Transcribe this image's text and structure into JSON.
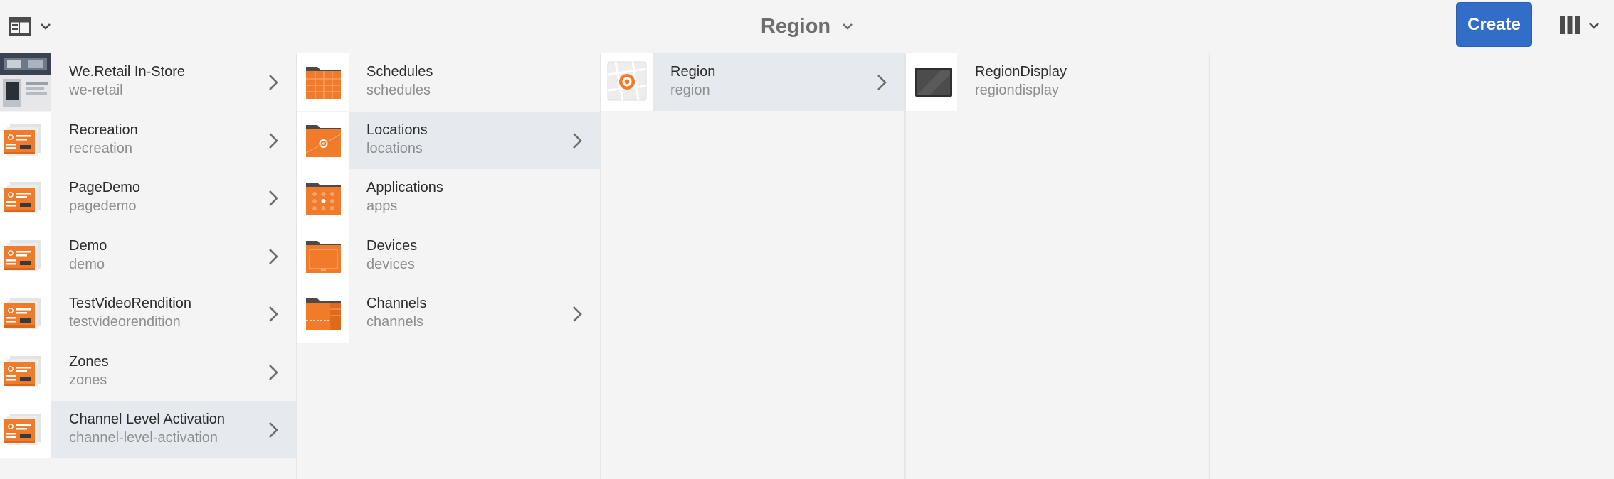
{
  "header": {
    "title": "Region",
    "create_label": "Create"
  },
  "icons": {
    "rail_toggle": "sidebar-panel-icon",
    "title_dropdown": "chevron-down-icon",
    "view_switch": "column-view-icon",
    "item_arrow": "chevron-right-icon"
  },
  "colors": {
    "primary_button": "#326ec8",
    "folder_orange": "#f07b2b",
    "active_row": "#e6e9ee"
  },
  "columns": [
    {
      "items": [
        {
          "title": "We.Retail In-Store",
          "name": "we-retail",
          "thumb": "photo",
          "has_children": true,
          "active": false
        },
        {
          "title": "Recreation",
          "name": "recreation",
          "thumb": "project",
          "has_children": true,
          "active": false
        },
        {
          "title": "PageDemo",
          "name": "pagedemo",
          "thumb": "project",
          "has_children": true,
          "active": false
        },
        {
          "title": "Demo",
          "name": "demo",
          "thumb": "project",
          "has_children": true,
          "active": false
        },
        {
          "title": "TestVideoRendition",
          "name": "testvideorendition",
          "thumb": "project",
          "has_children": true,
          "active": false
        },
        {
          "title": "Zones",
          "name": "zones",
          "thumb": "project",
          "has_children": true,
          "active": false
        },
        {
          "title": "Channel Level Activation",
          "name": "channel-level-activation",
          "thumb": "project",
          "has_children": true,
          "active": true
        }
      ]
    },
    {
      "items": [
        {
          "title": "Schedules",
          "name": "schedules",
          "thumb": "folder-schedules",
          "has_children": false,
          "active": false
        },
        {
          "title": "Locations",
          "name": "locations",
          "thumb": "folder-locations",
          "has_children": true,
          "active": true
        },
        {
          "title": "Applications",
          "name": "apps",
          "thumb": "folder-apps",
          "has_children": false,
          "active": false
        },
        {
          "title": "Devices",
          "name": "devices",
          "thumb": "folder-devices",
          "has_children": false,
          "active": false
        },
        {
          "title": "Channels",
          "name": "channels",
          "thumb": "folder-channels",
          "has_children": true,
          "active": false
        }
      ]
    },
    {
      "items": [
        {
          "title": "Region",
          "name": "region",
          "thumb": "region-map",
          "has_children": true,
          "active": true
        }
      ]
    },
    {
      "items": [
        {
          "title": "RegionDisplay",
          "name": "regiondisplay",
          "thumb": "display",
          "has_children": false,
          "active": false
        }
      ]
    },
    {
      "items": []
    }
  ]
}
